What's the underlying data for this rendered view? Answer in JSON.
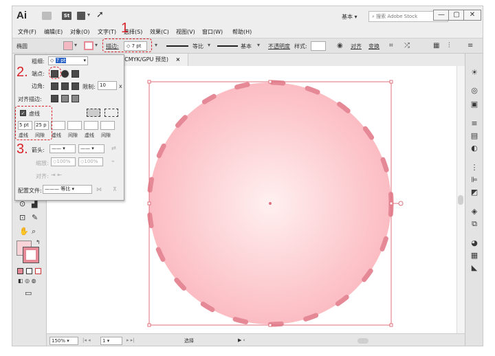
{
  "app": {
    "logo": "Ai",
    "stock_icon": "St",
    "workspace": "基本",
    "search_placeholder": "搜索 Adobe Stock",
    "window_buttons": [
      "—",
      "▢",
      "✕"
    ]
  },
  "menus": [
    "文件(F)",
    "编辑(E)",
    "对象(O)",
    "文字(T)",
    "选择(S)",
    "效果(C)",
    "视图(V)",
    "窗口(W)",
    "帮助(H)"
  ],
  "control_bar": {
    "object_type": "椭圆",
    "stroke_label": "描边:",
    "stroke_value": "7 pt",
    "profile_label": "等比",
    "brush_label": "基本",
    "opacity_label": "不透明度",
    "style_label": "样式:",
    "align_label": "对齐",
    "transform_label": "变换"
  },
  "document_tab": {
    "title": "(CMYK/GPU 预览)",
    "close": "×"
  },
  "stroke_panel": {
    "weight_label": "粗细:",
    "weight_value": "7 pt",
    "cap_label": "端点:",
    "corner_label": "边角:",
    "limit_label": "限制:",
    "limit_value": "10",
    "limit_unit": "x",
    "align_label": "对齐描边:",
    "dashed_label": "虚线",
    "dash_values": [
      "5 pt",
      "25 p",
      "",
      "",
      "",
      ""
    ],
    "dash_headers": [
      "虚线",
      "间隙",
      "虚线",
      "间隙",
      "虚线",
      "间隙"
    ],
    "arrow_label": "箭头:",
    "scale_label": "缩放:",
    "scale_1": "100%",
    "scale_2": "100%",
    "arrow_align_label": "对齐:",
    "profile_label": "配置文件:",
    "profile_value": "等比"
  },
  "annotations": [
    "1",
    "2.",
    "3."
  ],
  "status_bar": {
    "zoom": "150%",
    "page": "1",
    "tool_label": "选择"
  },
  "colors": {
    "circle_fill_center": "#fff0f0",
    "circle_fill_edge": "#fbbcc2",
    "circle_stroke": "#e58997",
    "annotation": "#d9232a",
    "bounding_box": "#e0707c"
  },
  "icons": [
    "search-icon",
    "rocket-icon",
    "globe-icon",
    "close-icon",
    "chevron-down-icon"
  ]
}
